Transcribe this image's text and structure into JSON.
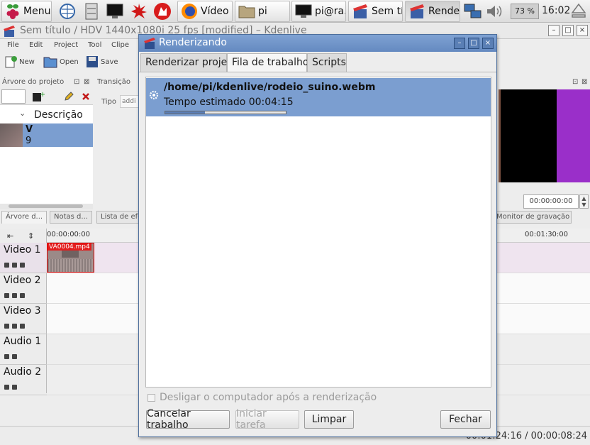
{
  "taskbar": {
    "menu_label": "Menu",
    "items": [
      {
        "label": "Vídeo ..."
      },
      {
        "label": "pi"
      },
      {
        "label": "pi@ra..."
      },
      {
        "label": "Sem tí..."
      },
      {
        "label": "Rende..."
      }
    ],
    "battery": "73 %",
    "clock": "16:02"
  },
  "kdenlive": {
    "title": "Sem título / HDV 1440x1080i 25 fps [modified] – Kdenlive",
    "menu": [
      "File",
      "Edit",
      "Project",
      "Tool",
      "Clipe"
    ],
    "toolbar": {
      "new": "New",
      "open": "Open",
      "save": "Save"
    },
    "project_tree_title": "Árvore do projeto",
    "transition_title": "Transição",
    "type_label": "Tipo",
    "type_placeholder": "addi",
    "description_header": "Descrição",
    "clip_name_line1": "V",
    "clip_name_line2": "9",
    "panel_tabs": [
      "Árvore d...",
      "Notas d...",
      "Lista de efe"
    ],
    "monitor_tab": "Monitor de gravação",
    "timecode": "00:00:00:00",
    "ruler": {
      "start": "00:00:00:00",
      "end": "00:01:30:00"
    },
    "tracks": [
      "Video 1",
      "Video 2",
      "Video 3",
      "Audio 1",
      "Audio 2"
    ],
    "clip_label": "VA0004.mp4",
    "status_time": "00:01:24:16 / 00:00:08:24"
  },
  "dialog": {
    "title": "Renderizando",
    "tabs": [
      "Renderizar projeto",
      "Fila de trabalhos",
      "Scripts"
    ],
    "job": {
      "path": "/home/pi/kdenlive/rodeio_suino.webm",
      "estimate": "Tempo estimado 00:04:15",
      "progress_percent": 33
    },
    "shutdown_label": "Desligar o computador após a renderização",
    "buttons": {
      "cancel": "Cancelar trabalho",
      "start": "Iniciar tarefa",
      "clean": "Limpar",
      "close": "Fechar"
    }
  }
}
